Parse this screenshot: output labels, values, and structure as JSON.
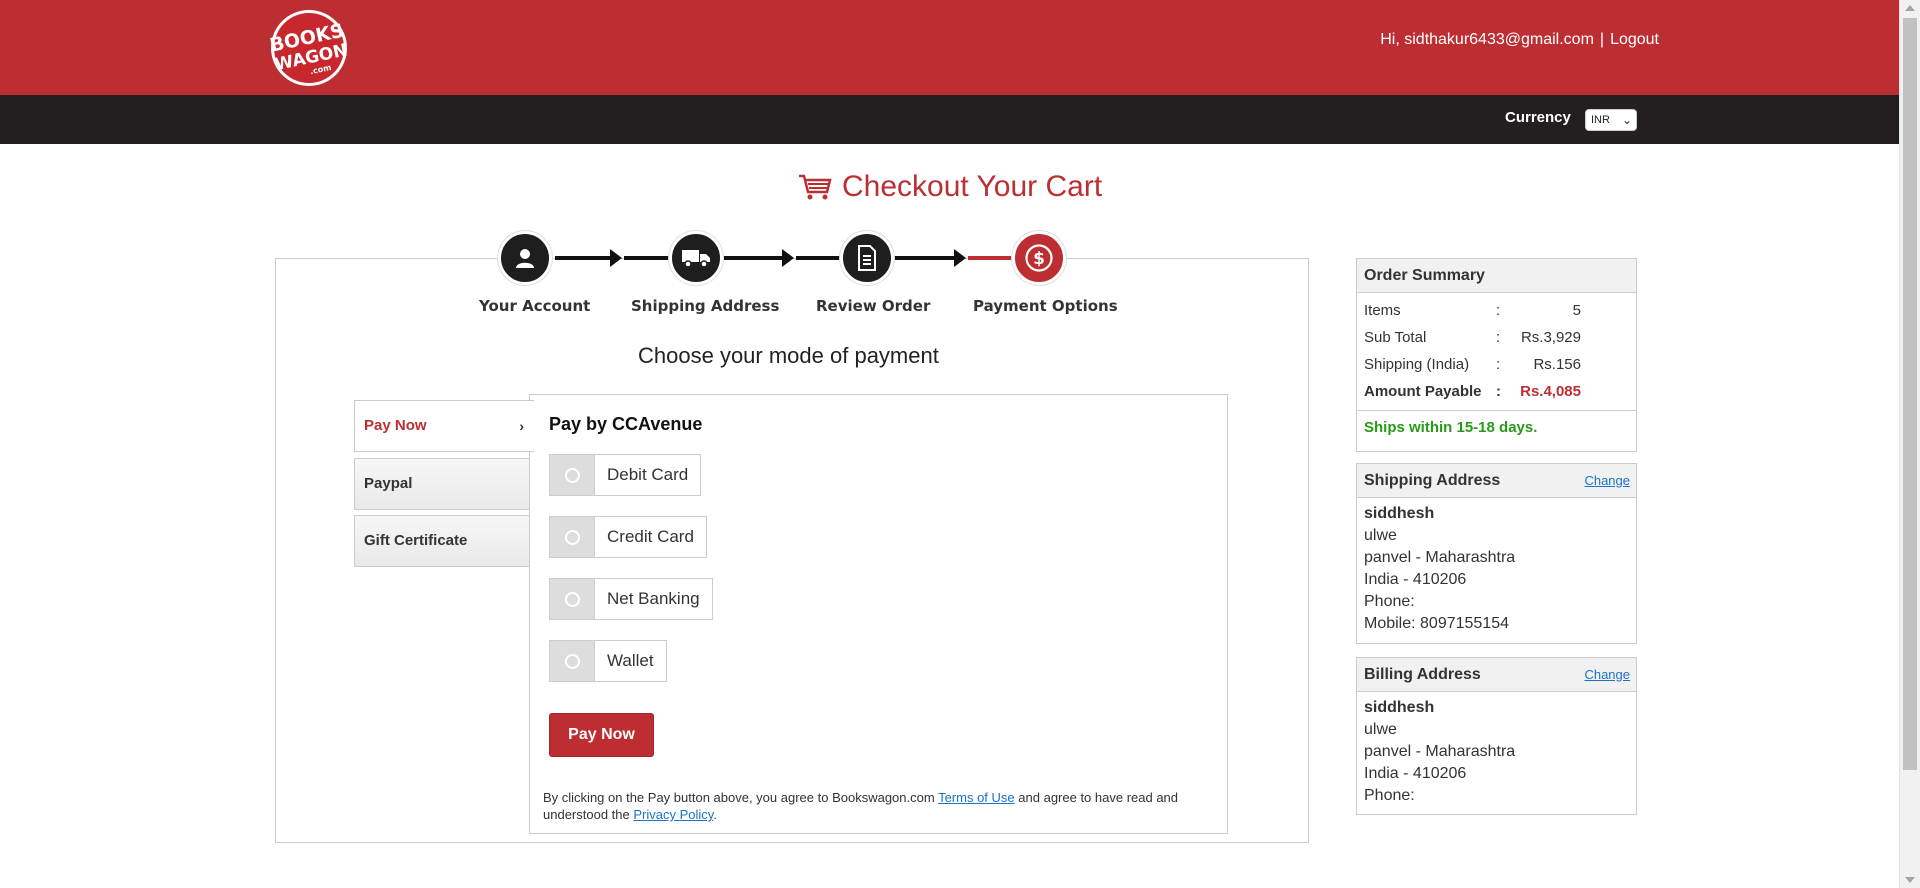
{
  "header": {
    "logo_text": "BOOKS WAGON .com",
    "greeting": "Hi, sidthakur6433@gmail.com",
    "separator": "|",
    "logout_label": "Logout"
  },
  "navbar": {
    "currency_label": "Currency",
    "currency_value": "INR"
  },
  "page": {
    "title": "Checkout Your Cart",
    "choose_mode": "Choose your mode of payment"
  },
  "steps": [
    {
      "label": "Your Account",
      "icon": "user-icon"
    },
    {
      "label": "Shipping Address",
      "icon": "truck-icon"
    },
    {
      "label": "Review Order",
      "icon": "document-icon"
    },
    {
      "label": "Payment Options",
      "icon": "dollar-icon"
    }
  ],
  "tabs": [
    {
      "label": "Pay Now",
      "active": true
    },
    {
      "label": "Paypal",
      "active": false
    },
    {
      "label": "Gift Certificate",
      "active": false
    }
  ],
  "payment": {
    "title": "Pay by CCAvenue",
    "options": [
      "Debit Card",
      "Credit Card",
      "Net Banking",
      "Wallet"
    ],
    "pay_button": "Pay Now",
    "terms_prefix": "By clicking on the Pay button above, you agree to Bookswagon.com",
    "terms_link": "Terms of Use",
    "terms_middle": "and agree to have read and understood the",
    "privacy_link": "Privacy Policy",
    "terms_suffix": "."
  },
  "order_summary": {
    "title": "Order Summary",
    "rows": [
      {
        "key": "Items",
        "colon": ":",
        "value": "5"
      },
      {
        "key": "Sub Total",
        "colon": ":",
        "value": "Rs.3,929"
      },
      {
        "key": "Shipping (India)",
        "colon": ":",
        "value": "Rs.156"
      },
      {
        "key": "Amount Payable",
        "colon": ":",
        "value": "Rs.4,085"
      }
    ],
    "ships_note": "Ships within 15-18 days."
  },
  "shipping_address": {
    "title": "Shipping Address",
    "change": "Change",
    "name": "siddhesh",
    "line1": "ulwe",
    "line2": "panvel - Maharashtra",
    "line3": "India - 410206",
    "phone": "Phone:",
    "mobile": "Mobile: 8097155154"
  },
  "billing_address": {
    "title": "Billing Address",
    "change": "Change",
    "name": "siddhesh",
    "line1": "ulwe",
    "line2": "panvel - Maharashtra",
    "line3": "India - 410206",
    "phone": "Phone:"
  },
  "colors": {
    "brand_red": "#bc2e32",
    "nav_dark": "#231f20",
    "success_green": "#2a9a1a",
    "link_blue": "#1a73c8"
  }
}
